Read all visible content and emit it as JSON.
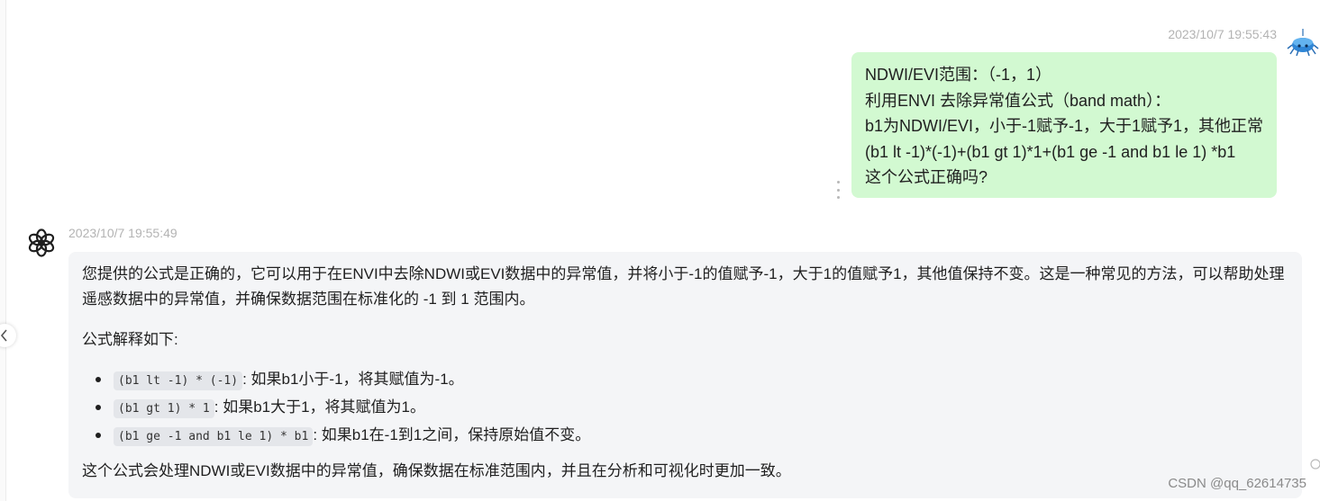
{
  "user_message": {
    "timestamp": "2023/10/7 19:55:43",
    "lines": [
      "NDWI/EVI范围：（-1，1）",
      "利用ENVI 去除异常值公式（band math）：",
      "b1为NDWI/EVI，小于-1赋予-1，大于1赋予1，其他正常",
      "(b1 lt -1)*(-1)+(b1 gt 1)*1+(b1 ge -1 and b1 le 1) *b1",
      "这个公式正确吗?"
    ],
    "bubble_color": "#d2f9d1"
  },
  "assistant_message": {
    "timestamp": "2023/10/7 19:55:49",
    "p1": "您提供的公式是正确的，它可以用于在ENVI中去除NDWI或EVI数据中的异常值，并将小于-1的值赋予-1，大于1的值赋予1，其他值保持不变。这是一种常见的方法，可以帮助处理遥感数据中的异常值，并确保数据范围在标准化的 -1 到 1 范围内。",
    "p2": "公式解释如下:",
    "items": [
      {
        "code": "(b1 lt -1) * (-1)",
        "text": ": 如果b1小于-1，将其赋值为-1。"
      },
      {
        "code": "(b1 gt 1) * 1",
        "text": ": 如果b1大于1，将其赋值为1。"
      },
      {
        "code": "(b1 ge -1 and b1 le 1) * b1",
        "text": ": 如果b1在-1到1之间，保持原始值不变。"
      }
    ],
    "p4": "这个公式会处理NDWI或EVI数据中的异常值，确保数据在标准范围内，并且在分析和可视化时更加一致。",
    "bubble_color": "#f4f5f7"
  },
  "watermark": "CSDN @qq_62614735",
  "icons": {
    "user_avatar": "blue-spider-avatar-icon",
    "assistant_avatar": "openai-logo-icon",
    "collapse": "chevron-left-icon",
    "more": "vertical-ellipsis-icon"
  }
}
